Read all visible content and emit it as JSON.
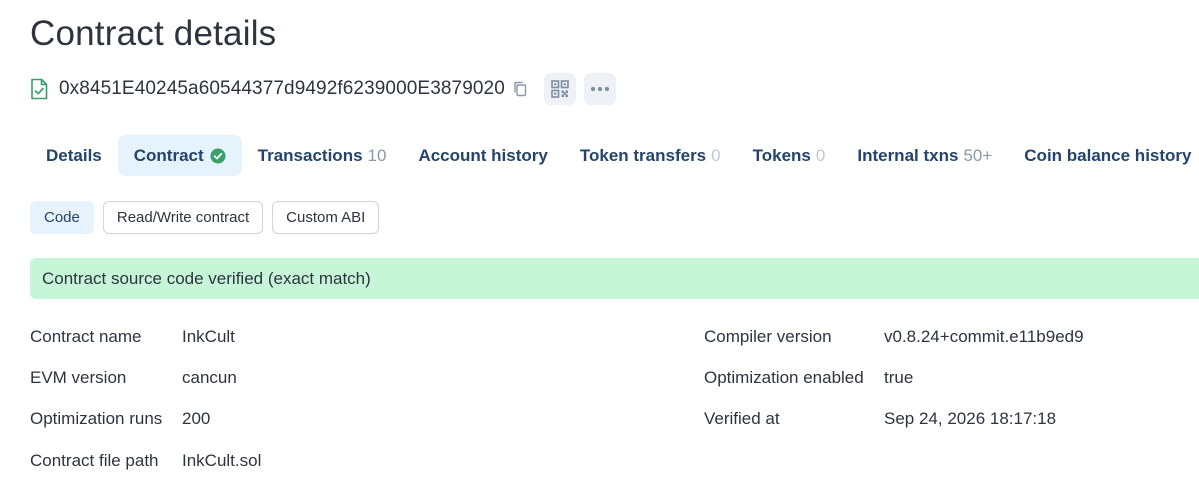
{
  "page": {
    "title": "Contract details"
  },
  "address": {
    "value": "0x8451E40245a60544377d9492f6239000E3879020"
  },
  "tabs": [
    {
      "label": "Details",
      "count": ""
    },
    {
      "label": "Contract",
      "count": ""
    },
    {
      "label": "Transactions",
      "count": "10"
    },
    {
      "label": "Account history",
      "count": ""
    },
    {
      "label": "Token transfers",
      "count": "0"
    },
    {
      "label": "Tokens",
      "count": "0"
    },
    {
      "label": "Internal txns",
      "count": "50+"
    },
    {
      "label": "Coin balance history",
      "count": ""
    }
  ],
  "subtabs": [
    {
      "label": "Code"
    },
    {
      "label": "Read/Write contract"
    },
    {
      "label": "Custom ABI"
    }
  ],
  "banner": {
    "text": "Contract source code verified (exact match)"
  },
  "details": {
    "contract_name": {
      "label": "Contract name",
      "value": "InkCult"
    },
    "evm_version": {
      "label": "EVM version",
      "value": "cancun"
    },
    "optimization_runs": {
      "label": "Optimization runs",
      "value": "200"
    },
    "file_path": {
      "label": "Contract file path",
      "value": "InkCult.sol"
    },
    "compiler_version": {
      "label": "Compiler version",
      "value": "v0.8.24+commit.e11b9ed9"
    },
    "optimization_enabled": {
      "label": "Optimization enabled",
      "value": "true"
    },
    "verified_at": {
      "label": "Verified at",
      "value": "Sep 24, 2026 18:17:18"
    }
  },
  "colors": {
    "accent": "#24446b",
    "active_tab_bg": "#e6f3fc",
    "success_bg": "#c6f6d7",
    "verified_green": "#38a169"
  },
  "icons": {
    "address": "file-check-icon",
    "copy": "copy-icon",
    "qr": "qr-code-icon",
    "more": "more-horizontal-icon",
    "verified": "check-circle-icon"
  }
}
